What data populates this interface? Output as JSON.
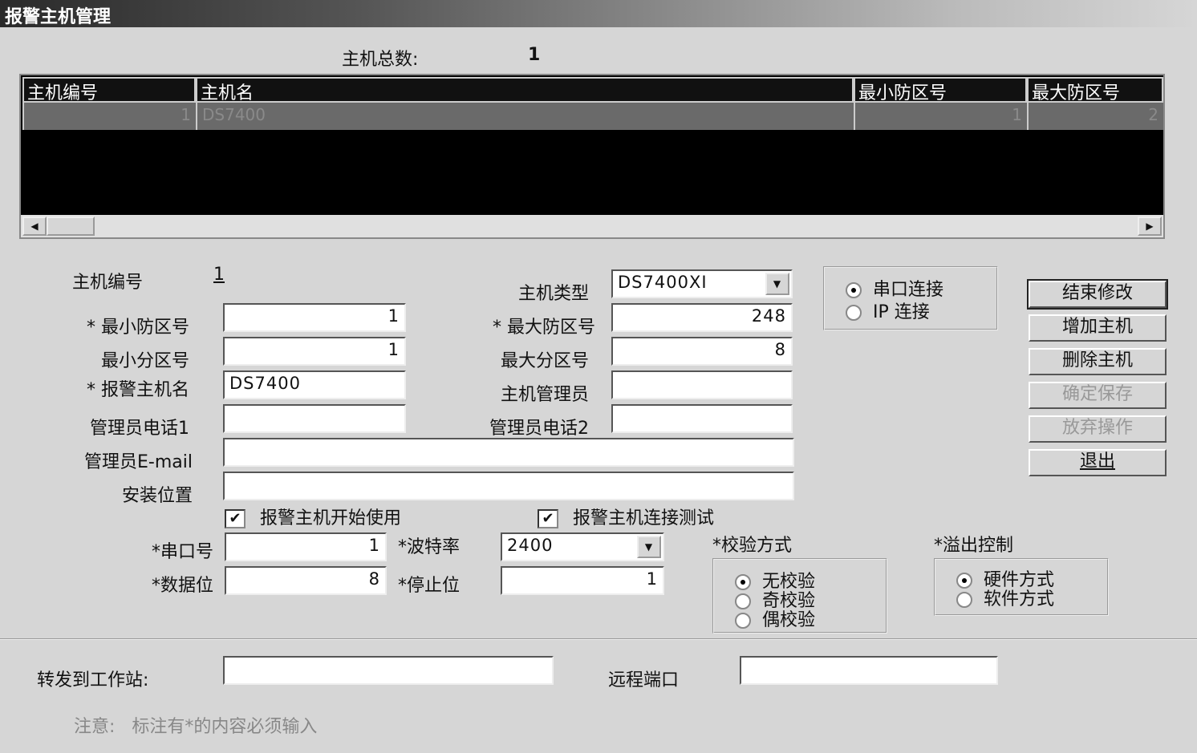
{
  "window": {
    "title": "报警主机管理"
  },
  "summary": {
    "label": "主机总数:",
    "value": "1"
  },
  "table": {
    "columns": [
      "主机编号",
      "主机名",
      "最小防区号",
      "最大防区号"
    ],
    "rows": [
      [
        "1",
        "DS7400",
        "1",
        "2"
      ]
    ]
  },
  "form": {
    "host_no_label": "主机编号",
    "host_no": "1",
    "host_type_label": "主机类型",
    "host_type": "DS7400XI",
    "min_zone_label": "* 最小防区号",
    "min_zone": "1",
    "max_zone_label": "* 最大防区号",
    "max_zone": "248",
    "min_part_label": "最小分区号",
    "min_part": "1",
    "max_part_label": "最大分区号",
    "max_part": "8",
    "name_label": "* 报警主机名",
    "name": "DS7400",
    "admin_label": "主机管理员",
    "admin": "",
    "phone1_label": "管理员电话1",
    "phone1": "",
    "phone2_label": "管理员电话2",
    "phone2": "",
    "email_label": "管理员E-mail",
    "email": "",
    "location_label": "安装位置",
    "location": "",
    "enable_label": "报警主机开始使用",
    "enable": true,
    "test_label": "报警主机连接测试",
    "test": true,
    "port_label": "*串口号",
    "port": "1",
    "baud_label": "*波特率",
    "baud": "2400",
    "databits_label": "*数据位",
    "databits": "8",
    "stopbits_label": "*停止位",
    "stopbits": "1",
    "forward_label": "转发到工作站:",
    "forward": "",
    "remote_port_label": "远程端口",
    "remote_port": "",
    "note": "注意:   标注有*的内容必须输入"
  },
  "connection": {
    "options": [
      "串口连接",
      "IP  连接"
    ],
    "selected": 0
  },
  "parity": {
    "label": "*校验方式",
    "options": [
      "无校验",
      "奇校验",
      "偶校验"
    ],
    "selected": 0
  },
  "flow": {
    "label": "*溢出控制",
    "options": [
      "硬件方式",
      "软件方式"
    ],
    "selected": 0
  },
  "buttons": {
    "end_edit": "结束修改",
    "add": "增加主机",
    "delete": "删除主机",
    "save": "确定保存",
    "cancel": "放弃操作",
    "exit": "退出"
  }
}
